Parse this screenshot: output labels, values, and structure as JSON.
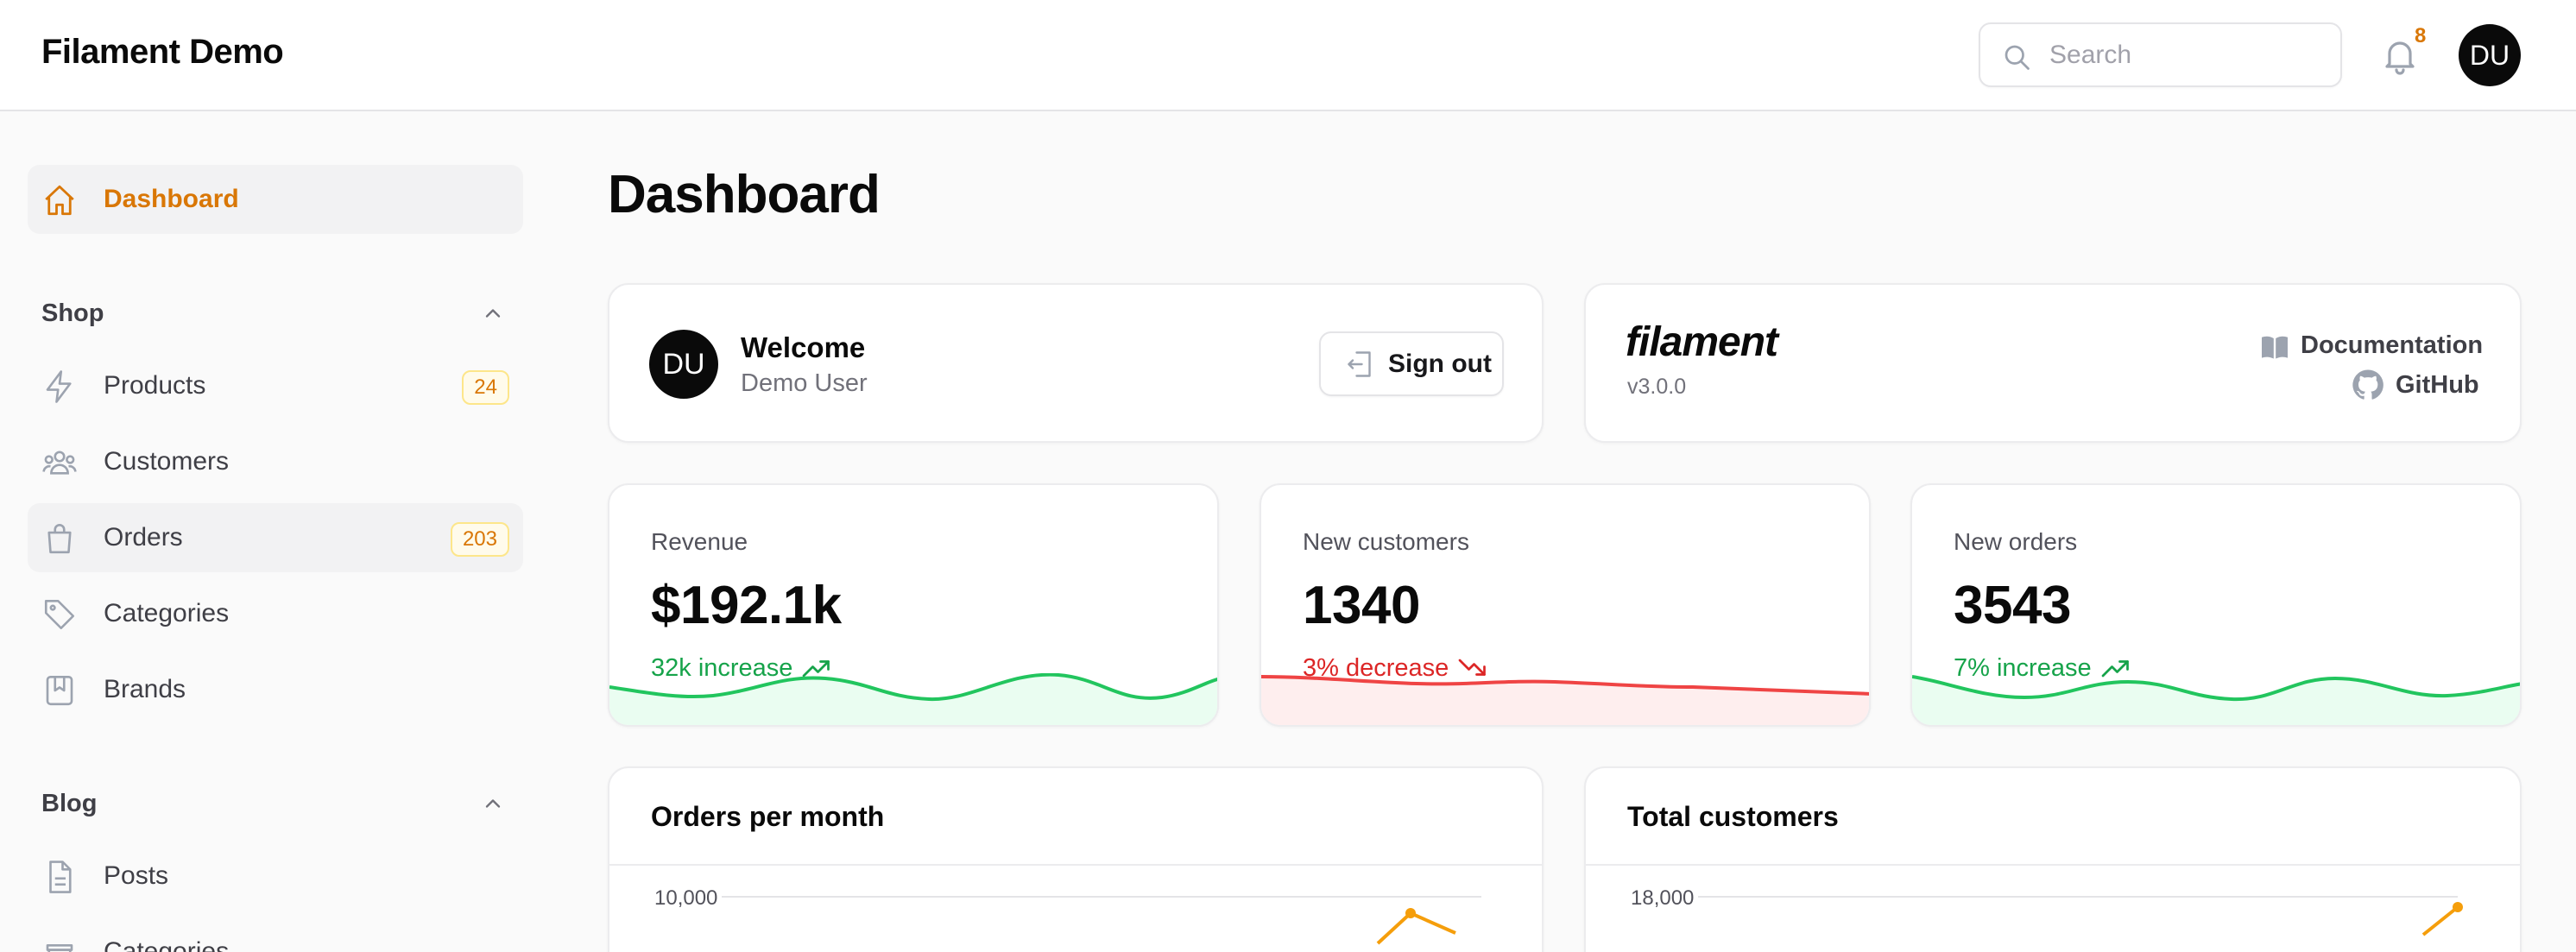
{
  "app": {
    "title": "Filament Demo"
  },
  "topbar": {
    "search_placeholder": "Search",
    "notification_count": "8",
    "user_initials": "DU",
    "icons": {
      "search": "search-icon",
      "bell": "bell-icon"
    }
  },
  "sidebar": {
    "dashboard": {
      "label": "Dashboard",
      "icon": "home-icon",
      "active": true
    },
    "groups": [
      {
        "title": "Shop",
        "collapsed": false,
        "items": [
          {
            "label": "Products",
            "icon": "bolt-icon",
            "badge": "24"
          },
          {
            "label": "Customers",
            "icon": "users-icon"
          },
          {
            "label": "Orders",
            "icon": "shopping-bag-icon",
            "badge": "203"
          },
          {
            "label": "Categories",
            "icon": "tag-icon"
          },
          {
            "label": "Brands",
            "icon": "bookmark-square-icon"
          }
        ]
      },
      {
        "title": "Blog",
        "collapsed": false,
        "items": [
          {
            "label": "Posts",
            "icon": "document-icon"
          },
          {
            "label": "Categories",
            "icon": "categories-icon"
          }
        ]
      }
    ]
  },
  "page": {
    "title": "Dashboard"
  },
  "welcome": {
    "title": "Welcome",
    "user_name": "Demo User",
    "initials": "DU",
    "sign_out_label": "Sign out"
  },
  "filament_info": {
    "logo_text": "filament",
    "version": "v3.0.0",
    "documentation_label": "Documentation",
    "github_label": "GitHub"
  },
  "stats": [
    {
      "label": "Revenue",
      "value": "$192.1k",
      "description": "32k increase",
      "trend": "up",
      "color": "#16a34a"
    },
    {
      "label": "New customers",
      "value": "1340",
      "description": "3% decrease",
      "trend": "down",
      "color": "#dc2626"
    },
    {
      "label": "New orders",
      "value": "3543",
      "description": "7% increase",
      "trend": "up",
      "color": "#16a34a"
    }
  ],
  "charts": [
    {
      "title": "Orders per month",
      "y_top_tick": "10,000",
      "series_color": "#f59e0b"
    },
    {
      "title": "Total customers",
      "y_top_tick": "18,000",
      "series_color": "#f59e0b"
    }
  ],
  "colors": {
    "primary": "#d97706",
    "success": "#16a34a",
    "danger": "#dc2626"
  }
}
